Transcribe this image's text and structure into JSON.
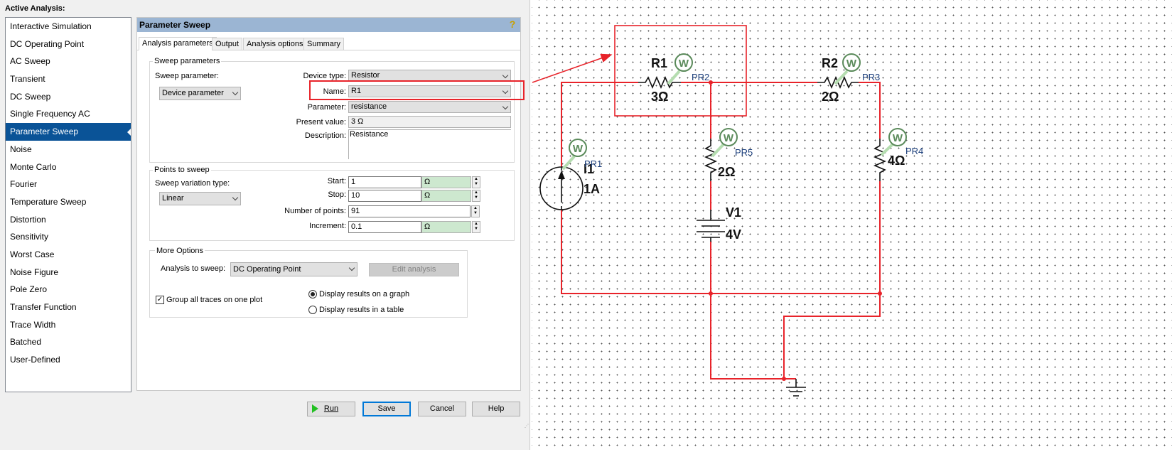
{
  "sidebar": {
    "title": "Active Analysis:",
    "items": [
      "Interactive Simulation",
      "DC Operating Point",
      "AC Sweep",
      "Transient",
      "DC Sweep",
      "Single Frequency AC",
      "Parameter Sweep",
      "Noise",
      "Monte Carlo",
      "Fourier",
      "Temperature Sweep",
      "Distortion",
      "Sensitivity",
      "Worst Case",
      "Noise Figure",
      "Pole Zero",
      "Transfer Function",
      "Trace Width",
      "Batched",
      "User-Defined"
    ],
    "selected": "Parameter Sweep"
  },
  "pane": {
    "title": "Parameter Sweep",
    "help_icon": "question-icon",
    "tabs": [
      "Analysis parameters",
      "Output",
      "Analysis options",
      "Summary"
    ],
    "sweep": {
      "group": "Sweep parameters",
      "sweep_param_label": "Sweep parameter:",
      "sweep_param": "Device parameter",
      "device_type_label": "Device type:",
      "device_type": "Resistor",
      "name_label": "Name:",
      "name": "R1",
      "parameter_label": "Parameter:",
      "parameter": "resistance",
      "present_label": "Present value:",
      "present": "3 Ω",
      "desc_label": "Description:",
      "desc": "Resistance"
    },
    "points": {
      "group": "Points to sweep",
      "variation_label": "Sweep variation type:",
      "variation": "Linear",
      "start_label": "Start:",
      "start": "1",
      "stop_label": "Stop:",
      "stop": "10",
      "num_label": "Number of points:",
      "num": "91",
      "inc_label": "Increment:",
      "inc": "0.1",
      "unit": "Ω"
    },
    "more": {
      "group": "More Options",
      "analysis_label": "Analysis to sweep:",
      "analysis": "DC Operating Point",
      "edit": "Edit analysis",
      "group_traces": "Group all traces on one plot",
      "group_traces_checked": true,
      "radio_graph": "Display results on a graph",
      "radio_table": "Display results in a table",
      "selected_display": "graph"
    }
  },
  "buttons": {
    "run": "Run",
    "save": "Save",
    "cancel": "Cancel",
    "help": "Help"
  },
  "circuit": {
    "wire_color": "#e8232a",
    "probe_color": "#5a8a5a",
    "labels": {
      "r1": "R1",
      "r1v": "3Ω",
      "r2": "R2",
      "r2v": "2Ω",
      "r5v": "2Ω",
      "r4v": "4Ω",
      "i1": "I1",
      "i1v": "1A",
      "v1": "V1",
      "v1v": "4V"
    },
    "probes": [
      "PR1",
      "PR2",
      "PR3",
      "PR4",
      "PR5"
    ],
    "probe_letter": "W"
  }
}
